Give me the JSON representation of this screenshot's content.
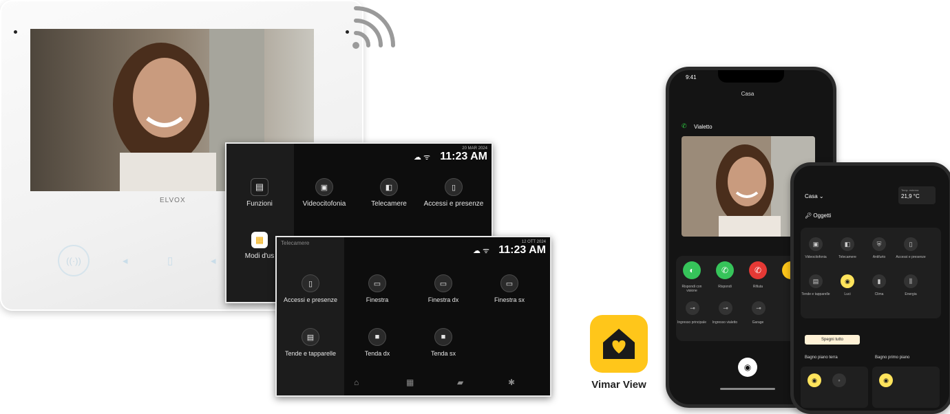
{
  "monitor": {
    "brand": "ELVOX"
  },
  "screen1": {
    "date": "20 MAR 2024",
    "time": "11:23 AM",
    "items": [
      {
        "label": "Funzioni",
        "icon": "functions-icon"
      },
      {
        "label": "Videocitofonia",
        "icon": "videointercom-icon"
      },
      {
        "label": "Telecamere",
        "icon": "camera-icon"
      },
      {
        "label": "Accessi e presenze",
        "icon": "door-icon"
      },
      {
        "label": "Modi d'us",
        "icon": "grid-icon"
      }
    ]
  },
  "screen2": {
    "title": "Telecamere",
    "date": "12 OTT 2024",
    "time": "11:23 AM",
    "items": [
      {
        "label": "Accessi e presenze",
        "icon": "door-icon"
      },
      {
        "label": "Finestra",
        "icon": "window-icon"
      },
      {
        "label": "Finestra dx",
        "icon": "window-icon"
      },
      {
        "label": "Finestra sx",
        "icon": "window-icon"
      },
      {
        "label": "Tende e tapparelle",
        "icon": "blinds-icon"
      },
      {
        "label": "Tenda dx",
        "icon": "blind-icon"
      },
      {
        "label": "Tenda sx",
        "icon": "blind-icon"
      }
    ]
  },
  "app": {
    "name": "Vimar View",
    "color": "#ffc61a"
  },
  "phone1": {
    "time": "9:41",
    "header": "Casa",
    "caller": "Vialetto",
    "actions": [
      "Rispondi con visione",
      "Rispondi",
      "Rifiuta"
    ],
    "locks": [
      "Ingresso principale",
      "Ingresso vialetto",
      "Garage"
    ]
  },
  "phone2": {
    "home": "Casa",
    "temp_label": "Temp. esterna",
    "temp": "21,9 °C",
    "section": "Oggetti",
    "items": [
      "Videocitofonia",
      "Telecamere",
      "Antifurto",
      "Accessi e presenze",
      "Tende e tapparelle",
      "Luci",
      "Clima",
      "Energia"
    ],
    "button": "Spegni tutto",
    "rooms": [
      "Bagno piano terra",
      "Bagno primo piano"
    ]
  }
}
